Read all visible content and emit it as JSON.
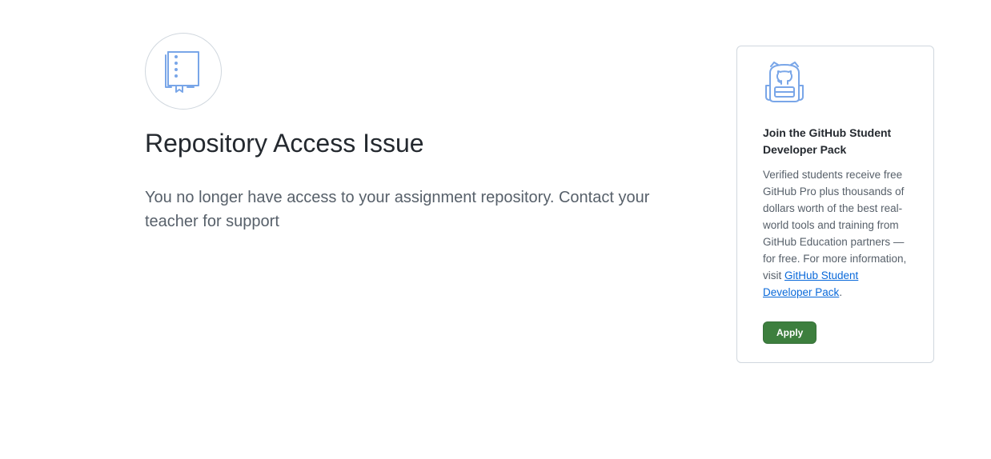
{
  "main": {
    "icon": "repo-book-icon",
    "title": "Repository Access Issue",
    "message": "You no longer have access to your assignment repository. Contact your teacher for support"
  },
  "card": {
    "icon": "backpack-icon",
    "title": "Join the GitHub Student Developer Pack",
    "body_text": "Verified students receive free GitHub Pro plus thousands of dollars worth of the best real-world tools and training from GitHub Education partners — for free. For more information, visit ",
    "link_text": "GitHub Student Developer Pack",
    "body_end": ".",
    "apply_label": "Apply"
  },
  "colors": {
    "icon_blue": "#79a6e8",
    "apply_green": "#3d7f3e",
    "link": "#0969da"
  }
}
